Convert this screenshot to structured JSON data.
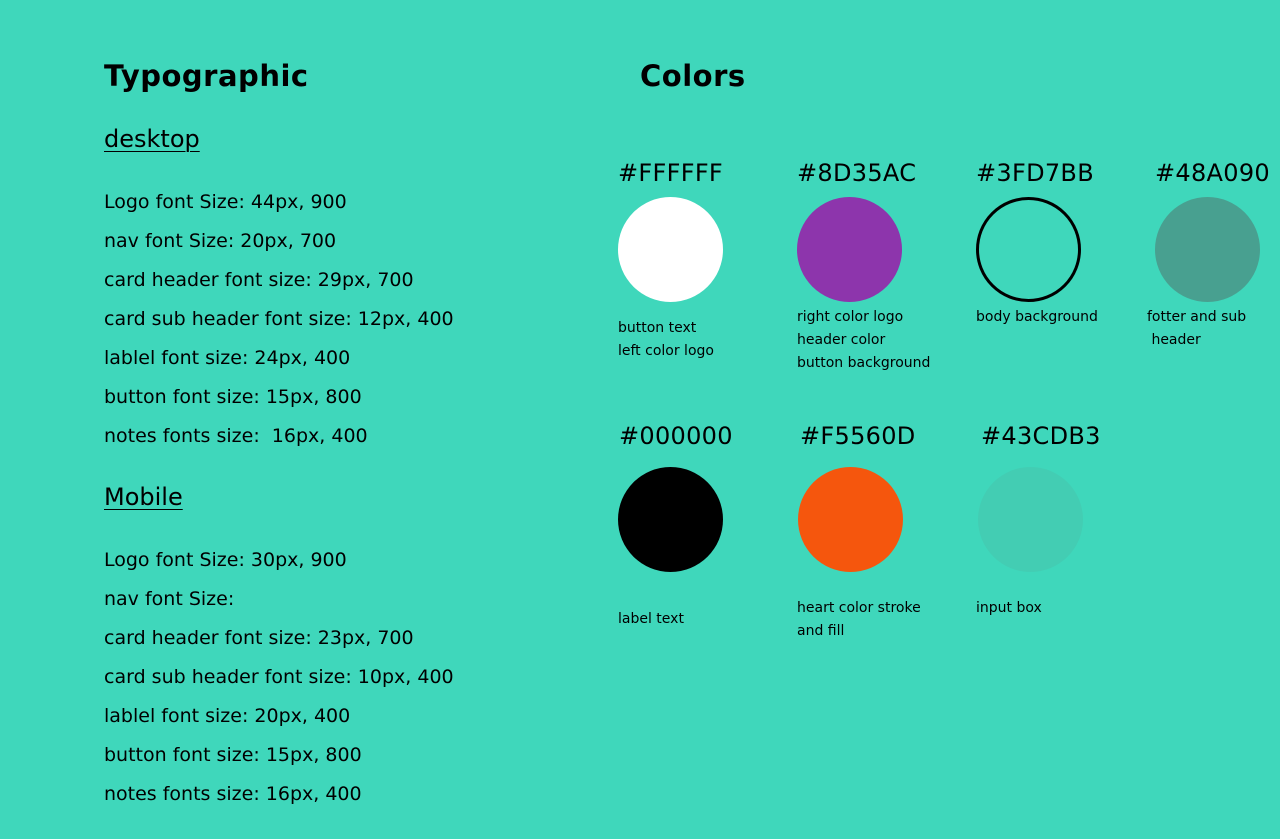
{
  "typographic": {
    "heading": "Typographic",
    "desktop": {
      "title": "desktop",
      "items": [
        "Logo font Size: 44px, 900",
        "nav font Size: 20px, 700",
        "card header font size: 29px, 700",
        "card sub header font size: 12px, 400",
        "lablel font size: 24px, 400",
        "button font size: 15px, 800",
        "notes fonts size:  16px, 400"
      ]
    },
    "mobile": {
      "title": "Mobile",
      "items": [
        "Logo font Size: 30px, 900",
        "nav font Size:",
        "card header font size: 23px, 700",
        "card sub header font size: 10px, 400",
        "lablel font size: 20px, 400",
        "button font size: 15px, 800",
        "notes fonts size: 16px, 400"
      ]
    }
  },
  "colors": {
    "heading": "Colors",
    "swatches": [
      {
        "hex": "#FFFFFF",
        "color": "#FFFFFF",
        "description": "button text\nleft color logo"
      },
      {
        "hex": "#8D35AC",
        "color": "#8D35AC",
        "description": "right color logo\nheader color\nbutton background"
      },
      {
        "hex": "#3FD7BB",
        "color": "#3FD7BB",
        "description": "body background"
      },
      {
        "hex": "#48A090",
        "color": "#48A090",
        "description": "fotter and sub\n header"
      },
      {
        "hex": "#000000",
        "color": "#000000",
        "description": "label text"
      },
      {
        "hex": "#F5560D",
        "color": "#F5560D",
        "description": "heart color stroke\nand fill"
      },
      {
        "hex": "#43CDB3",
        "color": "#43CDB3",
        "description": "input box"
      }
    ]
  }
}
